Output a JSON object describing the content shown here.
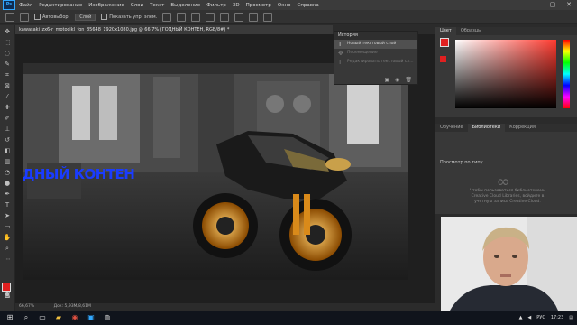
{
  "menu": {
    "logo": "Ps",
    "items": [
      "Файл",
      "Редактирование",
      "Изображение",
      "Слои",
      "Текст",
      "Выделение",
      "Фильтр",
      "3D",
      "Просмотр",
      "Окно",
      "Справка"
    ]
  },
  "options": {
    "autoselect_label": "Автовыбор:",
    "autoselect_value": "Слой",
    "show_controls_label": "Показать упр. элем."
  },
  "document": {
    "tab_title": "kawasaki_zx6-r_motocikl_fon_85648_1920x1080.jpg @ 66,7% (ГОДНЫЙ КОНТЕН, RGB/8#) *",
    "canvas_text": "ДНЫЙ КОНТЕН",
    "zoom": "66,67%",
    "doc_size": "Док: 5,93M/8,61M"
  },
  "history": {
    "title": "История",
    "items": [
      {
        "label": "Новый текстовый слой",
        "state": "active"
      },
      {
        "label": "Перемещение",
        "state": "dim"
      },
      {
        "label": "Редактировать текстовый сл...",
        "state": "dim"
      }
    ]
  },
  "color_panel": {
    "tabs": [
      "Цвет",
      "Образцы"
    ],
    "foreground": "#e02020",
    "background": "#ffffff"
  },
  "library_panel": {
    "tabs": [
      "Обучение",
      "Библиотеки",
      "Коррекция"
    ],
    "view_label": "Просмотр по типу",
    "message": "Чтобы пользоваться библиотеками Creative Cloud Libraries, войдите в учетную запись Creative Cloud."
  },
  "taskbar": {
    "language": "РУС",
    "time": "17:23"
  }
}
